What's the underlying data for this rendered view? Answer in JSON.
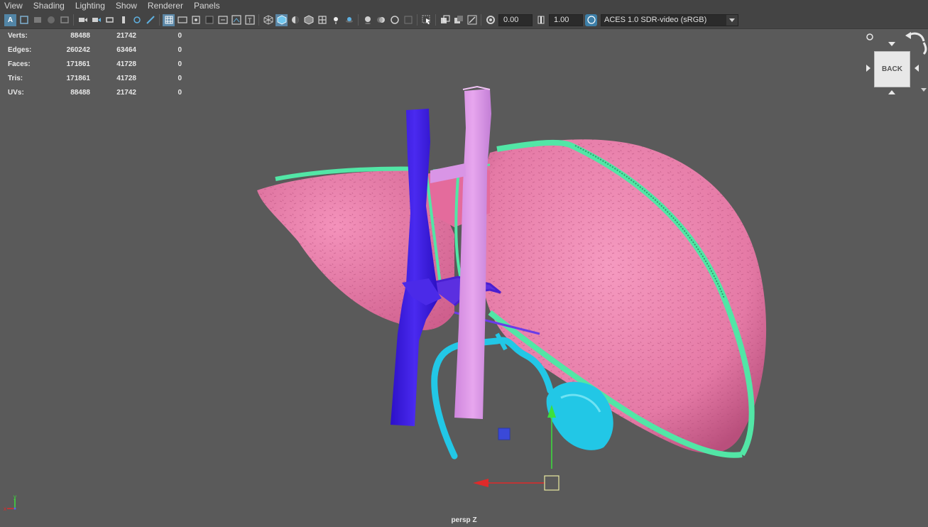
{
  "menubar": {
    "items": [
      "View",
      "Shading",
      "Lighting",
      "Show",
      "Renderer",
      "Panels"
    ]
  },
  "toolbar": {
    "exposure_value": "0.00",
    "gamma_value": "1.00",
    "color_space": "ACES 1.0 SDR-video (sRGB)",
    "icons": [
      "select-camera-icon",
      "camera-attributes-icon",
      "bookmark-icon",
      "image-plane-icon",
      "two-d-pan-icon",
      "grease-pencil-icon",
      "grid-icon",
      "film-gate-icon",
      "resolution-gate-icon",
      "gate-mask-icon",
      "field-chart-icon",
      "safe-action-icon",
      "safe-title-icon",
      "wireframe-icon",
      "smooth-shade-icon",
      "default-material-icon",
      "wireframe-on-shaded-icon",
      "textured-icon",
      "use-all-lights-icon",
      "shadows-icon",
      "screen-space-ao-icon",
      "motion-blur-icon",
      "multisample-aa-icon",
      "depth-of-field-icon",
      "isolate-select-icon",
      "x-ray-icon",
      "x-ray-active-components-icon",
      "x-ray-joints-icon",
      "exposure-icon",
      "gamma-icon",
      "color-management-icon"
    ]
  },
  "hud": {
    "rows": [
      {
        "label": "Verts:",
        "v1": "88488",
        "v2": "21742",
        "v3": "0"
      },
      {
        "label": "Edges:",
        "v1": "260242",
        "v2": "63464",
        "v3": "0"
      },
      {
        "label": "Faces:",
        "v1": "171861",
        "v2": "41728",
        "v3": "0"
      },
      {
        "label": "Tris:",
        "v1": "171861",
        "v2": "41728",
        "v3": "0"
      },
      {
        "label": "UVs:",
        "v1": "88488",
        "v2": "21742",
        "v3": "0"
      }
    ]
  },
  "viewcube": {
    "face_label": "BACK"
  },
  "viewport": {
    "camera_label": "persp Z",
    "axis_x": "x",
    "axis_y": "y"
  },
  "colors": {
    "background": "#5a5a5a",
    "liver": "#e97aa8",
    "ivc": "#3a1fe0",
    "portal_vein": "#dc8fe6",
    "bile_duct": "#22c7e6",
    "outline": "#52e6a6"
  }
}
